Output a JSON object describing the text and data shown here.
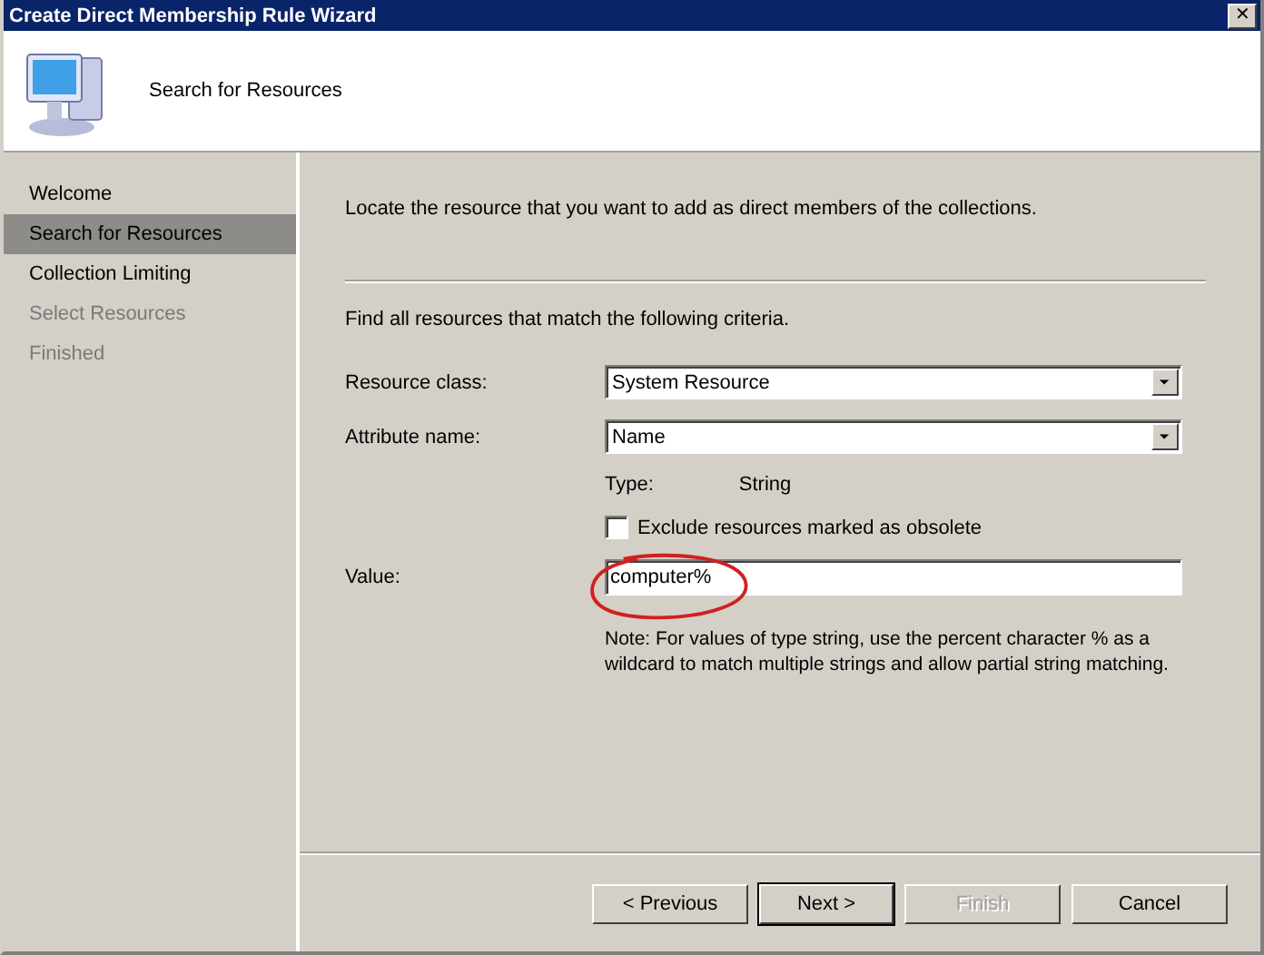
{
  "window": {
    "title": "Create Direct Membership Rule Wizard",
    "close": "✕"
  },
  "header": {
    "title": "Search for Resources"
  },
  "steps": [
    {
      "label": "Welcome",
      "selected": false,
      "disabled": false
    },
    {
      "label": "Search for Resources",
      "selected": true,
      "disabled": false
    },
    {
      "label": "Collection Limiting",
      "selected": false,
      "disabled": false
    },
    {
      "label": "Select Resources",
      "selected": false,
      "disabled": true
    },
    {
      "label": "Finished",
      "selected": false,
      "disabled": true
    }
  ],
  "intro": "Locate the resource that you want to add as direct members of the collections.",
  "criteria": "Find all resources that match the following criteria.",
  "resource_class": {
    "label": "Resource class:",
    "value": "System Resource"
  },
  "attribute_name": {
    "label": "Attribute name:",
    "value": "Name"
  },
  "type": {
    "label": "Type:",
    "value": "String"
  },
  "exclude_obsolete": {
    "label": "Exclude resources marked as obsolete",
    "checked": false
  },
  "value": {
    "label": "Value:",
    "value": "computer%"
  },
  "note": "Note: For values of type string, use the percent character % as a wildcard to match multiple strings and allow partial string matching.",
  "buttons": [
    {
      "label": "< Previous",
      "disabled": false,
      "default": false
    },
    {
      "label": "Next >",
      "disabled": false,
      "default": true
    },
    {
      "label": "Finish",
      "disabled": true,
      "default": false
    },
    {
      "label": "Cancel",
      "disabled": false,
      "default": false
    }
  ]
}
